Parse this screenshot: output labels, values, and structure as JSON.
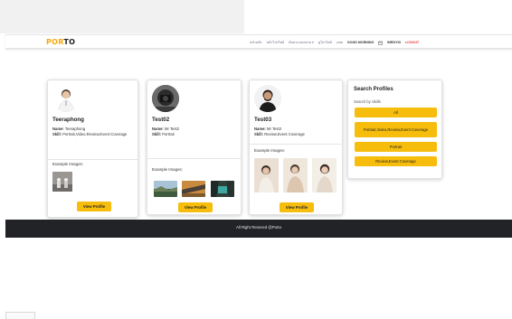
{
  "brand": {
    "logo_p": "P",
    "logo_or": "OR",
    "logo_to": "TO"
  },
  "nav": {
    "links": [
      "หน้าหลัก",
      "หน้าโปรไฟล์",
      "ค้นหาแบบหลาย ▾",
      "ดูโปรไฟล์",
      "แชท"
    ],
    "greeting": "GOOD MORNING",
    "user_icon": "calendar-icon",
    "username": "BIRDYSI",
    "logout": "LOGOUT"
  },
  "profiles": [
    {
      "name": "Teeraphong",
      "name_label": "Name:",
      "name_value": "Teeraphong",
      "skill_label": "Skill:",
      "skill_value": "Portrait,Video,Review,Event Coverage",
      "examples_label": "Example Images:",
      "button": "View Profile"
    },
    {
      "name": "Test02",
      "name_label": "Name:",
      "name_value": "Mr Test2",
      "skill_label": "Skill:",
      "skill_value": "Portrait",
      "examples_label": "Example Images:",
      "button": "View Profile"
    },
    {
      "name": "Test03",
      "name_label": "Name:",
      "name_value": "Mr Test3",
      "skill_label": "Skill:",
      "skill_value": "Review,Event Coverage",
      "examples_label": "Example Images:",
      "button": "View Profile"
    }
  ],
  "search": {
    "title": "Search Profiles",
    "subtitle": "Search by Skills",
    "options": [
      "All",
      "Portrait,Video,Review,Event Coverage",
      "Portrait",
      "Review,Event Coverage"
    ]
  },
  "footer": {
    "text": "All Right Reseved @Porto"
  },
  "colors": {
    "accent": "#f7bd0d",
    "logo": "#f4a70e",
    "logout": "#e53935",
    "footer_bg": "#222326"
  }
}
